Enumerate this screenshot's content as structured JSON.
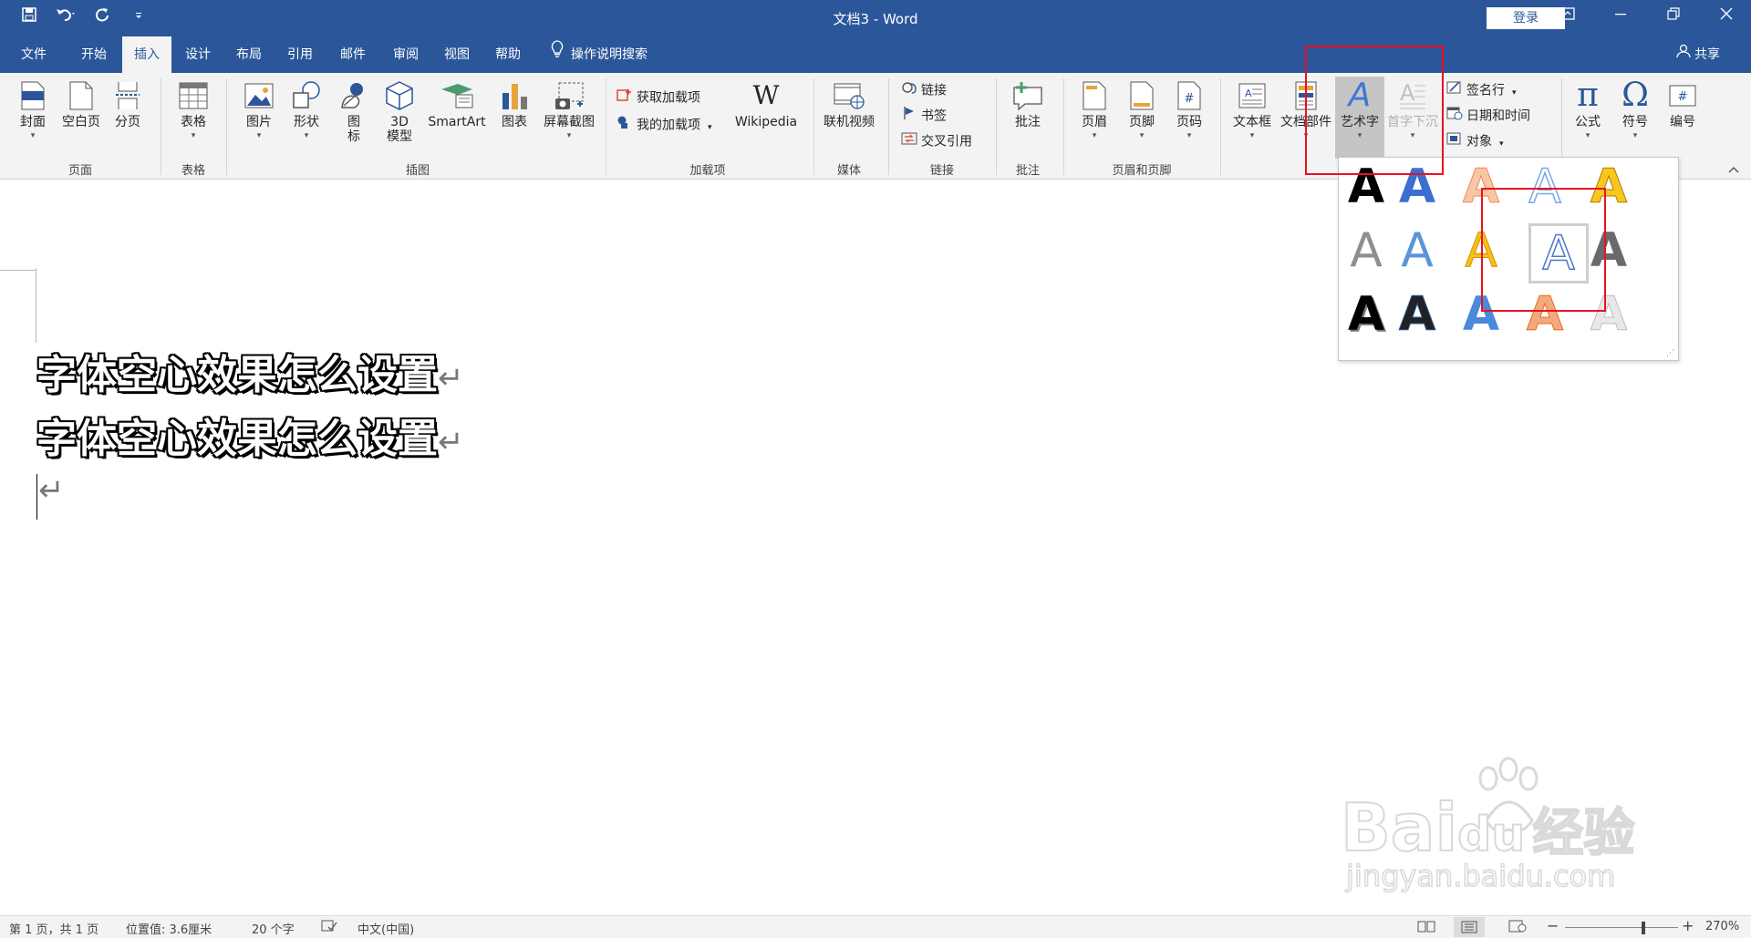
{
  "window": {
    "title": "文档3 - Word",
    "login_label": "登录"
  },
  "tabs": [
    {
      "label": "文件"
    },
    {
      "label": "开始"
    },
    {
      "label": "插入"
    },
    {
      "label": "设计"
    },
    {
      "label": "布局"
    },
    {
      "label": "引用"
    },
    {
      "label": "邮件"
    },
    {
      "label": "审阅"
    },
    {
      "label": "视图"
    },
    {
      "label": "帮助"
    }
  ],
  "tell_me": "操作说明搜索",
  "share": "共享",
  "ribbon": {
    "pages": {
      "cover": "封面",
      "blank": "空白页",
      "break": "分页",
      "group": "页面"
    },
    "tables": {
      "table": "表格",
      "group": "表格"
    },
    "illustrations": {
      "picture": "图片",
      "shapes": "形状",
      "icons": "图标",
      "model3d": "3D模型",
      "smartart": "SmartArt",
      "chart": "图表",
      "screenshot": "屏幕截图",
      "group": "插图"
    },
    "addins": {
      "get": "获取加载项",
      "my": "我的加载项",
      "wiki": "Wikipedia",
      "group": "加载项"
    },
    "media": {
      "video": "联机视频",
      "group": "媒体"
    },
    "links": {
      "link": "链接",
      "bookmark": "书签",
      "crossref": "交叉引用",
      "group": "链接"
    },
    "comments": {
      "comment": "批注",
      "group": "批注"
    },
    "headerfooter": {
      "header": "页眉",
      "footer": "页脚",
      "pagenum": "页码",
      "group": "页眉和页脚"
    },
    "text": {
      "textbox": "文本框",
      "parts": "文档部件",
      "wordart": "艺术字",
      "dropcap": "首字下沉",
      "signature": "签名行",
      "datetime": "日期和时间",
      "object": "对象"
    },
    "symbols": {
      "equation": "公式",
      "symbol": "符号",
      "number": "编号"
    }
  },
  "document": {
    "lines": [
      "字体空心效果怎么设置",
      "字体空心效果怎么设置"
    ]
  },
  "wordart_gallery": {
    "glyph": "A"
  },
  "status": {
    "page": "第 1 页，共 1 页",
    "position": "位置值: 3.6厘米",
    "words": "20 个字",
    "language": "中文(中国)",
    "zoom": "270%"
  },
  "watermark": {
    "brand": "Bai",
    "brand2": "du",
    "brand3": "经验",
    "url": "jingyan.baidu.com"
  },
  "colors": {
    "titlebar": "#2b579a",
    "ribbon": "#f3f3f3",
    "highlight": "#e81123"
  }
}
